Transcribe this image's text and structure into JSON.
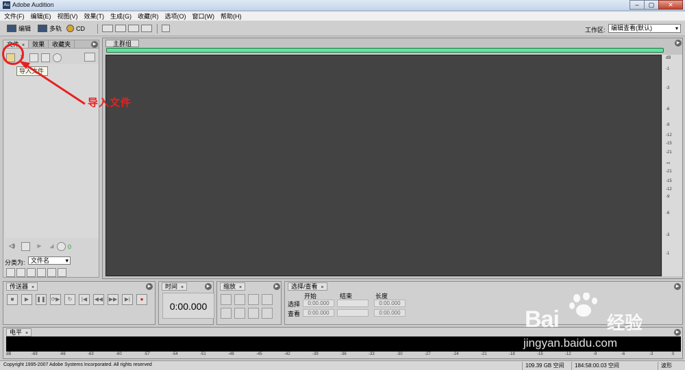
{
  "app": {
    "title": "Adobe Audition",
    "icon_text": "Au"
  },
  "window_buttons": [
    "–",
    "▢",
    "✕"
  ],
  "menu": [
    "文件(F)",
    "编辑(E)",
    "视图(V)",
    "效果(T)",
    "生成(G)",
    "收藏(R)",
    "选项(O)",
    "窗口(W)",
    "帮助(H)"
  ],
  "toolbar": {
    "edit": "编辑",
    "multitrack": "多轨",
    "cd": "CD",
    "workspace_label": "工作区:",
    "workspace_value": "编辑查看(默认)"
  },
  "left_panel": {
    "tabs": [
      "文件",
      "效果",
      "收藏夹"
    ],
    "tooltip": "导入文件",
    "sort_label": "分类为:",
    "sort_value": "文件名",
    "autoplay_value": "0"
  },
  "annotation": {
    "label": "导入文件",
    "color": "#e82020"
  },
  "main": {
    "tab": "主群组",
    "overview_color": "#5ce69a",
    "waveform_bg": "#434343",
    "db_ticks": [
      "dB",
      "-1",
      "-3",
      "-6",
      "-9",
      "-12",
      "-15",
      "-21",
      "-∞",
      "-21",
      "-15",
      "-12",
      "-9",
      "-6",
      "-3",
      "-1"
    ]
  },
  "transport": {
    "title": "传送器",
    "buttons": [
      "■",
      "▶",
      "❚❚",
      "⟳▶",
      "↻",
      "|◀",
      "◀◀",
      "▶▶",
      "▶|",
      "●"
    ]
  },
  "time": {
    "title": "时间",
    "value": "0:00.000"
  },
  "zoom": {
    "title": "缩放"
  },
  "selection": {
    "title": "选择/查看",
    "headers": [
      "开始",
      "结束",
      "长度"
    ],
    "rows": [
      {
        "label": "选择",
        "start": "0:00.000",
        "end": "",
        "length": "0:00.000"
      },
      {
        "label": "查看",
        "start": "0:00.000",
        "end": "",
        "length": "0:00.000"
      }
    ]
  },
  "level": {
    "title": "电平",
    "scale": [
      "dB",
      "-69",
      "-66",
      "-63",
      "-60",
      "-57",
      "-54",
      "-51",
      "-48",
      "-45",
      "-42",
      "-39",
      "-36",
      "-33",
      "-30",
      "-27",
      "-24",
      "-21",
      "-18",
      "-15",
      "-12",
      "-9",
      "-6",
      "-3",
      "0"
    ]
  },
  "status": {
    "copyright": "Copyright 1995-2007 Adobe Systems Incorporated. All rights reserved",
    "disk": "109.39 GB 空间",
    "time_free": "184:58:00.03 空间",
    "mode": "波形"
  },
  "watermark": {
    "brand": "Bai",
    "brand2": "经验",
    "url": "jingyan.baidu.com"
  }
}
